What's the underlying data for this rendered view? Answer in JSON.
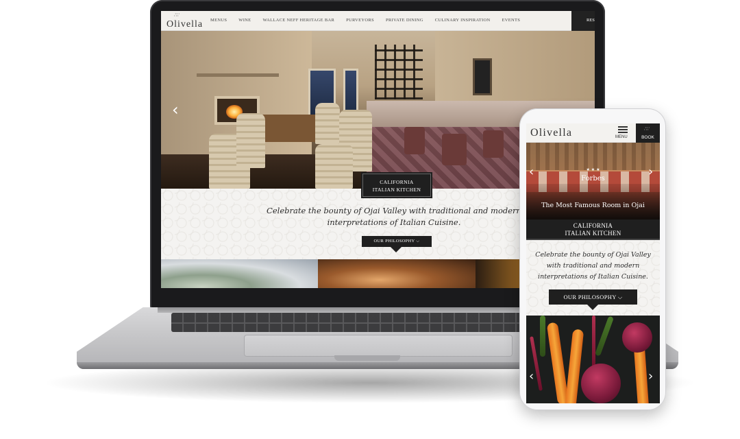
{
  "desktop": {
    "logo": "Olivella",
    "nav_items": [
      "MENUS",
      "WINE",
      "WALLACE NEFF HERITAGE BAR",
      "PURVEYORS",
      "PRIVATE DINING",
      "CULINARY INSPIRATION",
      "EVENTS"
    ],
    "book_label": "RES",
    "hero_prev_arrow": "‹",
    "tag_line1": "CALIFORNIA",
    "tag_line2": "ITALIAN KITCHEN",
    "intro_text": "Celebrate the bounty of Ojai Valley with traditional and modern interpretations of Italian Cuisine.",
    "cta_label": "OUR PHILOSOPHY ⌵"
  },
  "mobile": {
    "logo": "Olivella",
    "menu_label": "MENU",
    "book_label": "BOOK",
    "forbes_stars": "★ ★ ★",
    "forbes_label": "Forbes",
    "hero_caption": "The Most Famous Room in Ojai",
    "prev_arrow": "‹",
    "next_arrow": "›",
    "tag_line1": "CALIFORNIA",
    "tag_line2": "ITALIAN KITCHEN",
    "intro_text": "Celebrate the bounty of Ojai Valley with traditional and modern interpretations of Italian Cuisine.",
    "cta_label": "OUR PHILOSOPHY ⌵"
  },
  "colors": {
    "dark_ui": "#1f1f1f",
    "pattern_bg": "#f4f3f1",
    "device_silver": "#c8c8ca",
    "bezel": "#1a1a1c"
  }
}
